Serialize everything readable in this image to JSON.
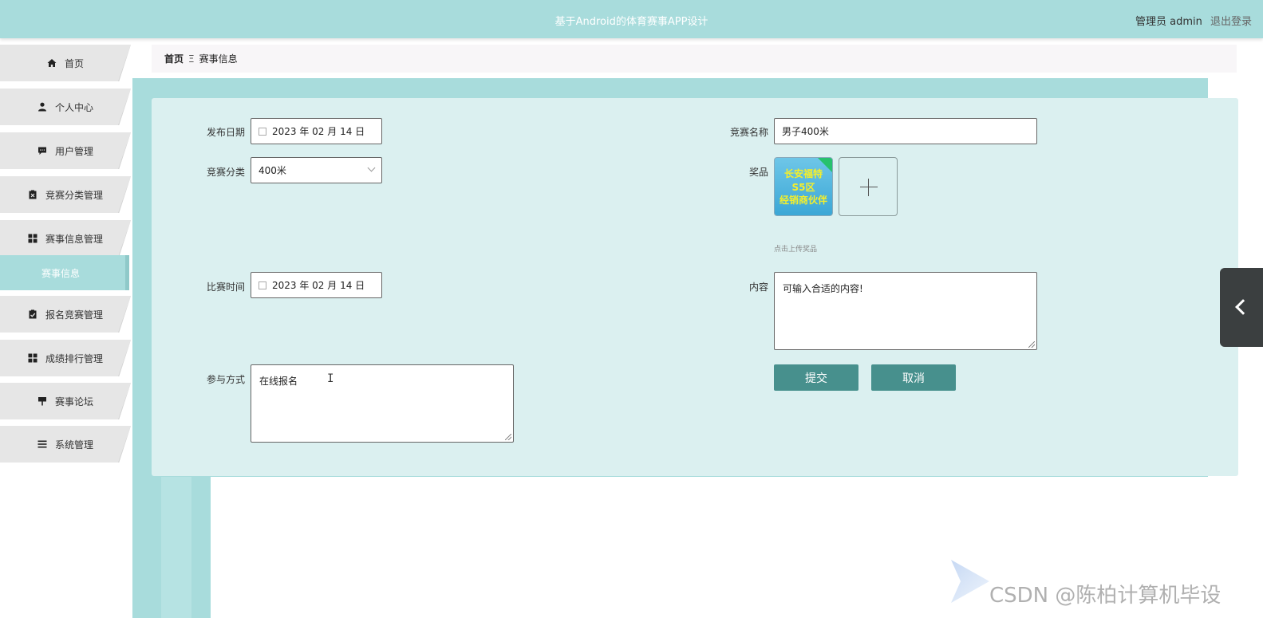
{
  "header": {
    "title": "基于Android的体育赛事APP设计",
    "user": "管理员 admin",
    "logout": "退出登录"
  },
  "sidebar": {
    "items": [
      {
        "label": "首页",
        "icon": "home-icon"
      },
      {
        "label": "个人中心",
        "icon": "user-icon"
      },
      {
        "label": "用户管理",
        "icon": "chat-icon"
      },
      {
        "label": "竞赛分类管理",
        "icon": "clipboard-icon"
      },
      {
        "label": "赛事信息管理",
        "icon": "grid-icon"
      },
      {
        "label": "赛事信息",
        "icon": "",
        "active": true
      },
      {
        "label": "报名竞赛管理",
        "icon": "clipboard-check-icon"
      },
      {
        "label": "成绩排行管理",
        "icon": "grid-icon"
      },
      {
        "label": "赛事论坛",
        "icon": "signpost-icon"
      },
      {
        "label": "系统管理",
        "icon": "menu-icon"
      }
    ]
  },
  "breadcrumb": {
    "home": "首页",
    "separator": "Ξ",
    "current": "赛事信息"
  },
  "form": {
    "publish_date": {
      "label": "发布日期",
      "value": "2023 年 02 月 14 日"
    },
    "competition_name": {
      "label": "竞赛名称",
      "value": "男子400米"
    },
    "category": {
      "label": "竞赛分类",
      "value": "400米"
    },
    "prize": {
      "label": "奖品",
      "image_text_line1": "长安福特S5区",
      "image_text_line2": "经销商伙伴",
      "hint": "点击上传奖品"
    },
    "match_time": {
      "label": "比赛时间",
      "value": "2023 年 02 月 14 日"
    },
    "content": {
      "label": "内容",
      "value": "可输入合适的内容!"
    },
    "participation": {
      "label": "参与方式",
      "value": "在线报名"
    },
    "submit": "提交",
    "cancel": "取消"
  },
  "watermark": "CSDN @陈柏计算机毕设",
  "colors": {
    "header_bg": "#a8dcdc",
    "card_bg": "#dbf0f0",
    "button_bg": "#47908d",
    "active_nav": "#a8dcdc"
  }
}
